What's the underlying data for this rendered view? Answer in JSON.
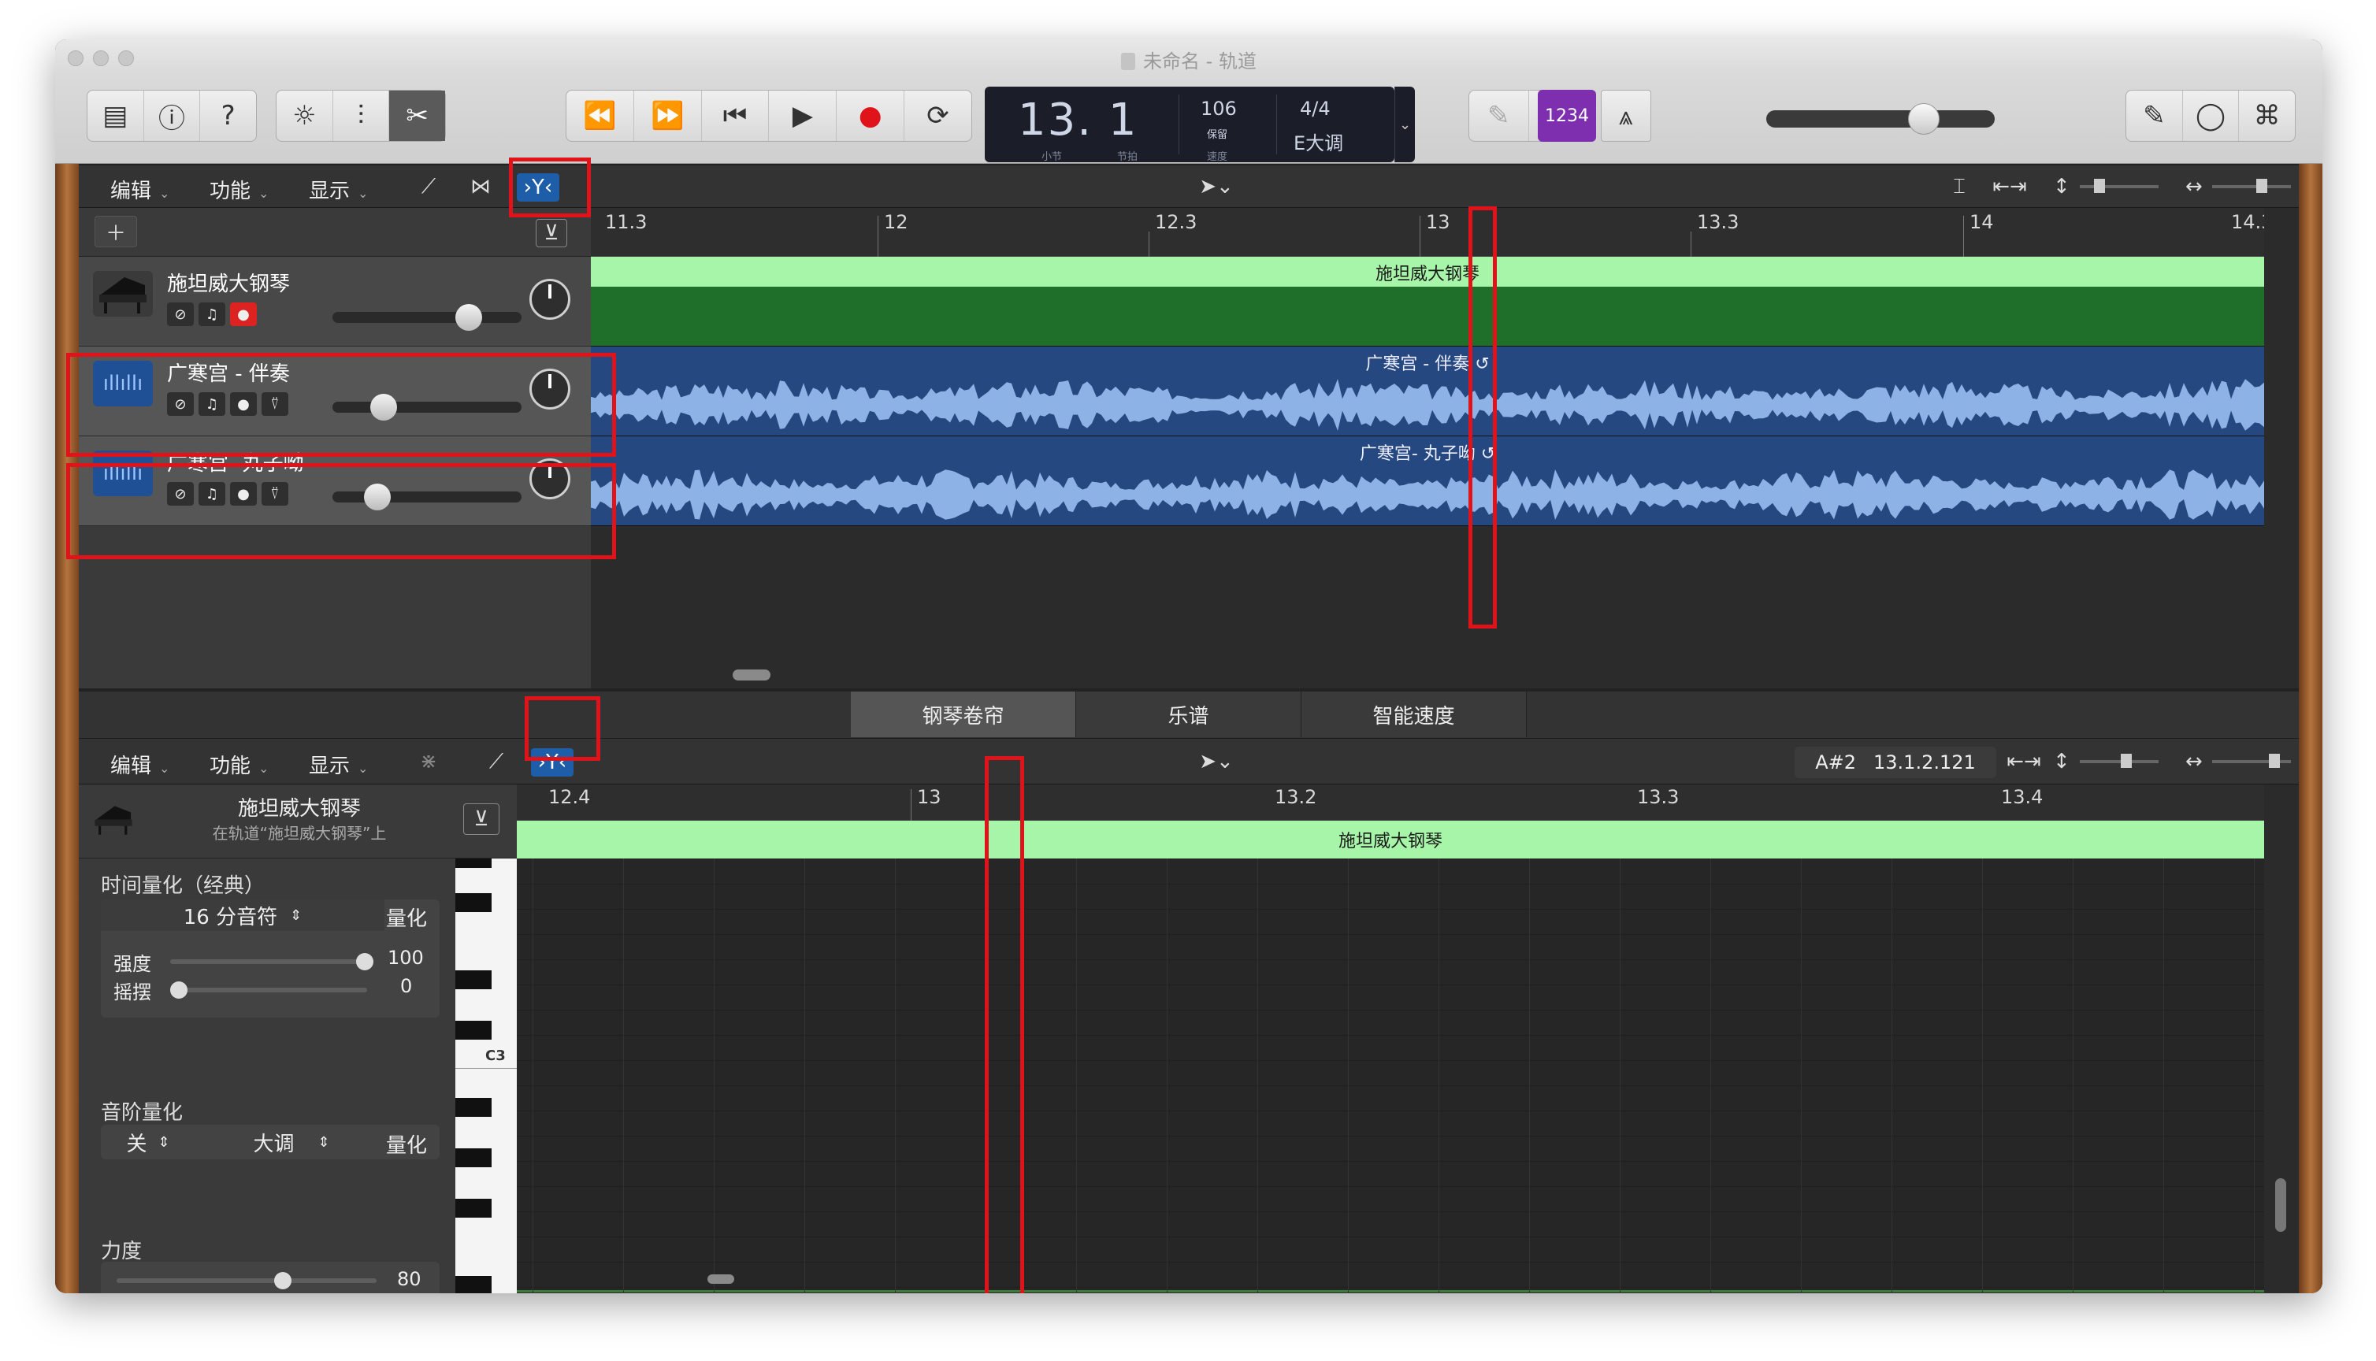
{
  "window": {
    "title": "未命名 - 轨道"
  },
  "lcd": {
    "bar_beat": "13. 1",
    "bar_label": "小节",
    "beat_label": "节拍",
    "tempo": "106",
    "tempo_mode": "保留",
    "tempo_label": "速度",
    "time_signature": "4/4",
    "key": "E大调"
  },
  "count_in": "1234",
  "tracks_bar": {
    "edit": "编辑",
    "functions": "功能",
    "view": "显示"
  },
  "ruler_top": [
    "11.3",
    "12",
    "12.3",
    "13",
    "13.3",
    "14",
    "14.3"
  ],
  "tracks": [
    {
      "name": "施坦威大钢琴",
      "region": "施坦威大钢琴",
      "volume": 0.72
    },
    {
      "name": "广寒宫 - 伴奏",
      "region": "广寒宫 - 伴奏",
      "volume": 0.2
    },
    {
      "name": "广寒宫- 丸子呦",
      "region": "广寒宫- 丸子呦",
      "volume": 0.17
    }
  ],
  "editor": {
    "tabs": [
      "钢琴卷帘",
      "乐谱",
      "智能速度"
    ],
    "edit": "编辑",
    "functions": "功能",
    "view": "显示",
    "note_info": "A#2",
    "position": "13.1.2.121",
    "region_name": "施坦威大钢琴",
    "region_sub": "在轨道“施坦威大钢琴”上",
    "ruler": [
      "12.4",
      "13",
      "13.2",
      "13.3",
      "13.4"
    ],
    "key_label": "C3"
  },
  "inspector": {
    "time_quant_label": "时间量化（经典）",
    "note_value": "16 分音符",
    "quantize_btn": "量化",
    "strength_label": "强度",
    "strength_value": "100",
    "swing_label": "摇摆",
    "swing_value": "0",
    "scale_quant_label": "音阶量化",
    "scale_off": "关",
    "scale_type": "大调",
    "scale_quant_btn": "量化",
    "velocity_label": "力度",
    "velocity_value": "80"
  },
  "colors": {
    "midi_region": "#1f6e2a",
    "midi_header": "#a7f5a8",
    "audio_region": "#24487f",
    "highlight": "#e0131b",
    "count_in": "#7d2fb0"
  }
}
